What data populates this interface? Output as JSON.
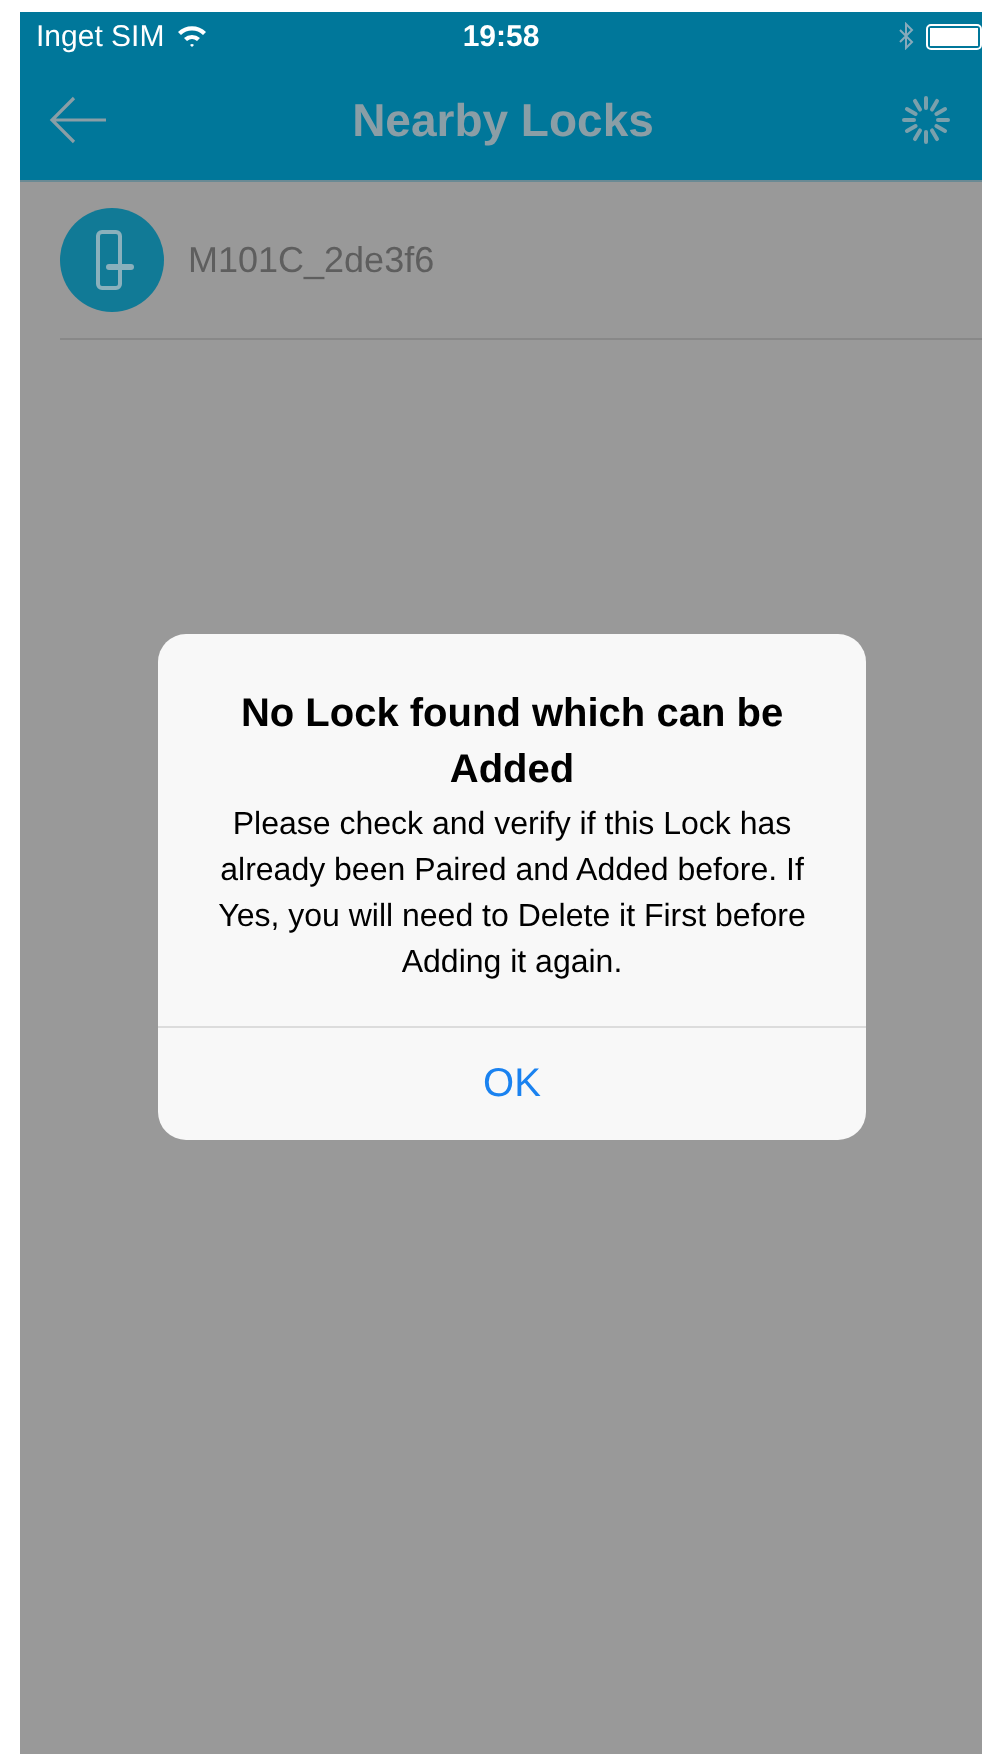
{
  "status_bar": {
    "carrier": "Inget SIM",
    "time": "19:58"
  },
  "nav": {
    "title": "Nearby Locks"
  },
  "locks": [
    {
      "name": "M101C_2de3f6"
    }
  ],
  "alert": {
    "title": "No Lock found which can be Added",
    "message": "Please check and verify if this Lock has already been Paired and Added before. If Yes, you will need to Delete it First before Adding it again.",
    "button": "OK"
  }
}
